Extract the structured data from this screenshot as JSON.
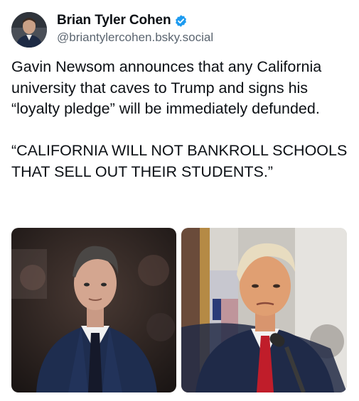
{
  "post": {
    "author": {
      "display_name": "Brian Tyler Cohen",
      "handle": "@briantylercohen.bsky.social",
      "verified_icon": "verified-check-icon",
      "verified_color": "#1d9bf0"
    },
    "paragraphs": [
      "Gavin Newsom announces that any California university that caves to Trump and signs his “loyalty pledge” will be immediately defunded.",
      "“CALIFORNIA WILL NOT BANKROLL SCHOOLS THAT SELL OUT THEIR STUDENTS.”"
    ],
    "images": [
      {
        "name": "newsom-photo"
      },
      {
        "name": "trump-photo"
      }
    ]
  }
}
